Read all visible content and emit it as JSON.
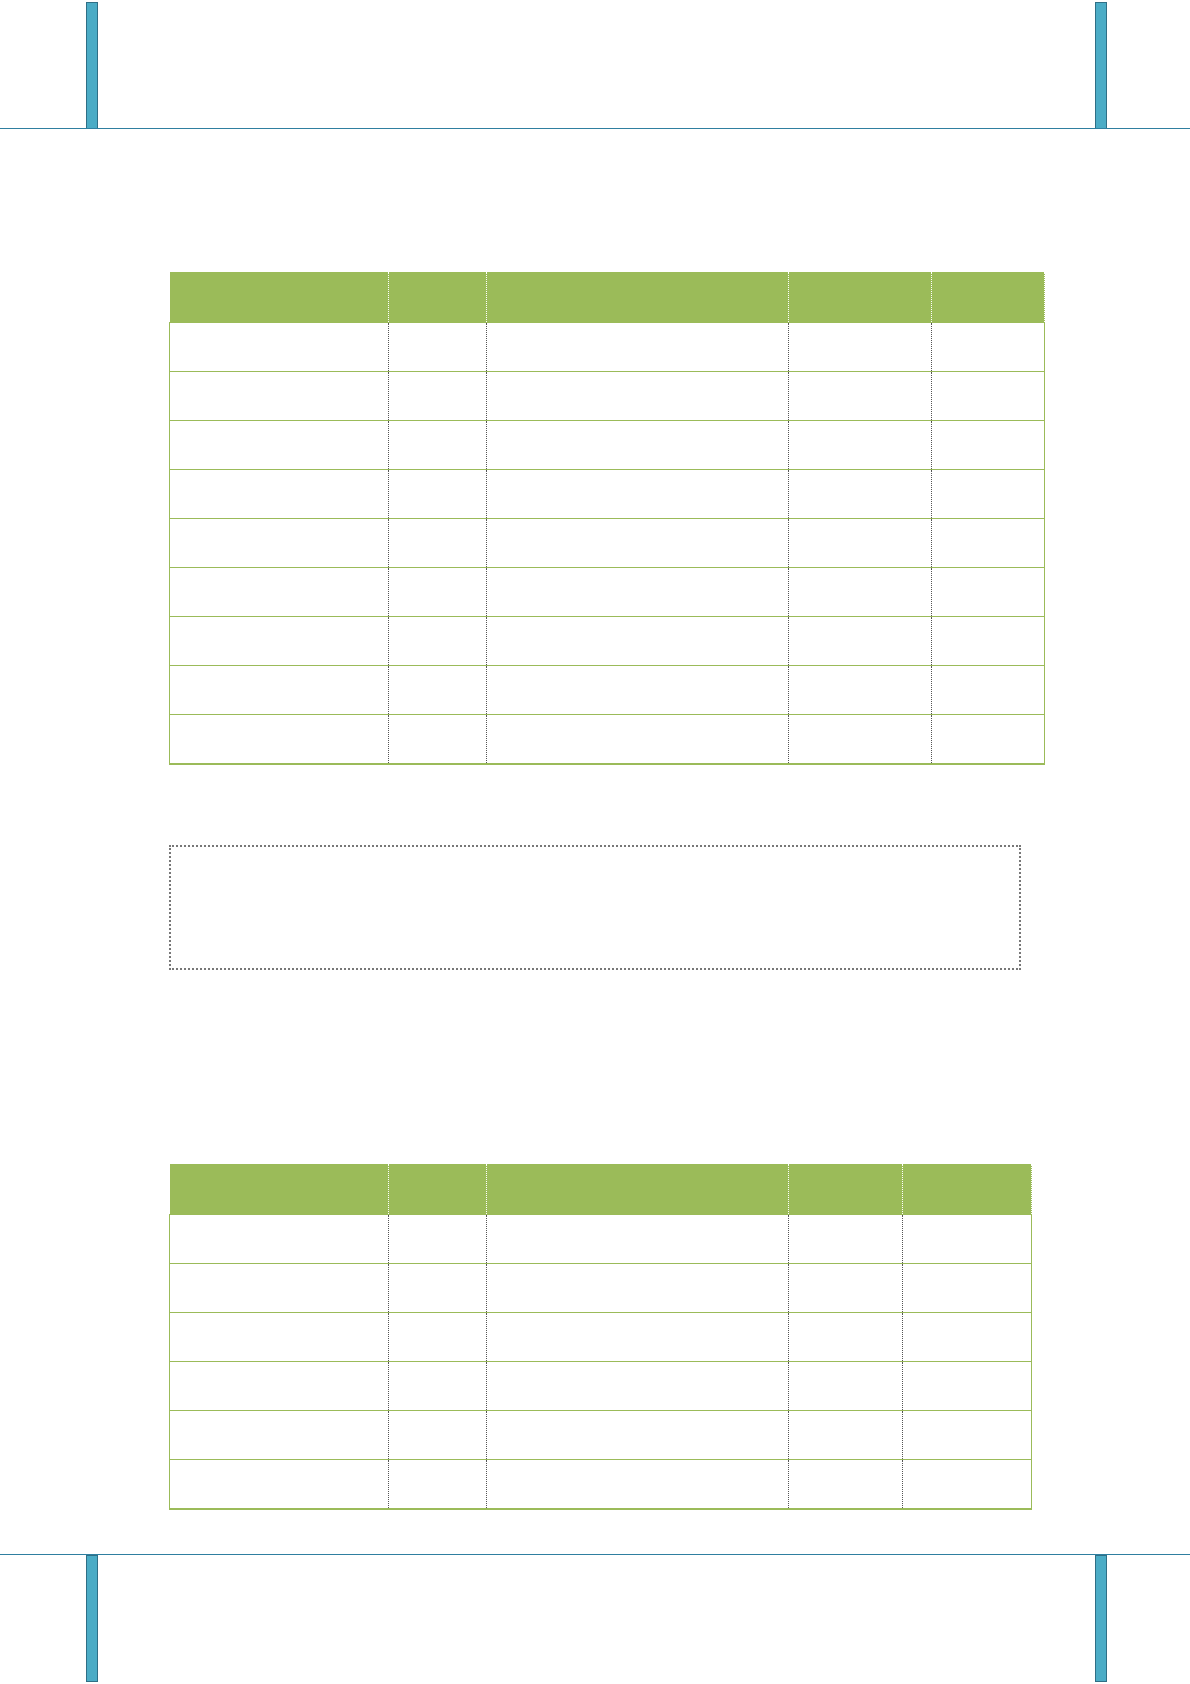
{
  "table1": {
    "headers": [
      "",
      "",
      "",
      "",
      ""
    ],
    "rows": [
      [
        "",
        "",
        "",
        "",
        ""
      ],
      [
        "",
        "",
        "",
        "",
        ""
      ],
      [
        "",
        "",
        "",
        "",
        ""
      ],
      [
        "",
        "",
        "",
        "",
        ""
      ],
      [
        "",
        "",
        "",
        "",
        ""
      ],
      [
        "",
        "",
        "",
        "",
        ""
      ],
      [
        "",
        "",
        "",
        "",
        ""
      ],
      [
        "",
        "",
        "",
        "",
        ""
      ],
      [
        "",
        "",
        "",
        "",
        ""
      ]
    ]
  },
  "note": {
    "text": ""
  },
  "table2": {
    "headers": [
      "",
      "",
      "",
      "",
      ""
    ],
    "rows": [
      [
        "",
        "",
        "",
        "",
        ""
      ],
      [
        "",
        "",
        "",
        "",
        ""
      ],
      [
        "",
        "",
        "",
        "",
        ""
      ],
      [
        "",
        "",
        "",
        "",
        ""
      ],
      [
        "",
        "",
        "",
        "",
        ""
      ],
      [
        "",
        "",
        "",
        "",
        ""
      ]
    ]
  },
  "colors": {
    "accent_bar": "#4bacc6",
    "header_fill": "#9bbb59",
    "rule": "#2f7fa0"
  }
}
